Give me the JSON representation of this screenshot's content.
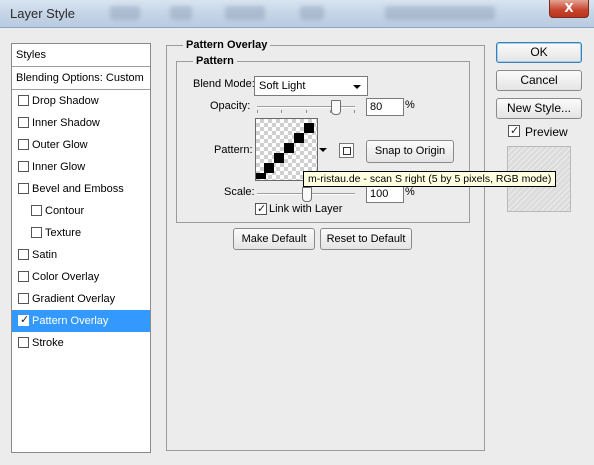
{
  "window": {
    "title": "Layer Style",
    "close_label": "X"
  },
  "styles_list": {
    "header": "Styles",
    "blending": "Blending Options: Custom",
    "items": [
      {
        "label": "Drop Shadow",
        "checked": false,
        "indent": false,
        "selected": false
      },
      {
        "label": "Inner Shadow",
        "checked": false,
        "indent": false,
        "selected": false
      },
      {
        "label": "Outer Glow",
        "checked": false,
        "indent": false,
        "selected": false
      },
      {
        "label": "Inner Glow",
        "checked": false,
        "indent": false,
        "selected": false
      },
      {
        "label": "Bevel and Emboss",
        "checked": false,
        "indent": false,
        "selected": false
      },
      {
        "label": "Contour",
        "checked": false,
        "indent": true,
        "selected": false
      },
      {
        "label": "Texture",
        "checked": false,
        "indent": true,
        "selected": false
      },
      {
        "label": "Satin",
        "checked": false,
        "indent": false,
        "selected": false
      },
      {
        "label": "Color Overlay",
        "checked": false,
        "indent": false,
        "selected": false
      },
      {
        "label": "Gradient Overlay",
        "checked": false,
        "indent": false,
        "selected": false
      },
      {
        "label": "Pattern Overlay",
        "checked": true,
        "indent": false,
        "selected": true
      },
      {
        "label": "Stroke",
        "checked": false,
        "indent": false,
        "selected": false
      }
    ]
  },
  "panel": {
    "title": "Pattern Overlay",
    "group_title": "Pattern",
    "blend_mode_label": "Blend Mode:",
    "blend_mode_value": "Soft Light",
    "opacity_label": "Opacity:",
    "opacity_value": "80",
    "opacity_percent": 80,
    "percent_sign": "%",
    "pattern_label": "Pattern:",
    "snap_label": "Snap to Origin",
    "scale_label": "Scale:",
    "scale_value": "100",
    "scale_percent": 100,
    "link_label": "Link with Layer",
    "link_checked": true,
    "make_default_label": "Make Default",
    "reset_default_label": "Reset to Default"
  },
  "tooltip": {
    "text": "m-ristau.de - scan S right (5 by 5 pixels, RGB mode)"
  },
  "actions": {
    "ok_label": "OK",
    "cancel_label": "Cancel",
    "new_style_label": "New Style...",
    "preview_label": "Preview",
    "preview_checked": true
  },
  "colors": {
    "selection": "#3399ff",
    "dialog_bg": "#ececec",
    "tooltip_bg": "#ffffe1"
  }
}
